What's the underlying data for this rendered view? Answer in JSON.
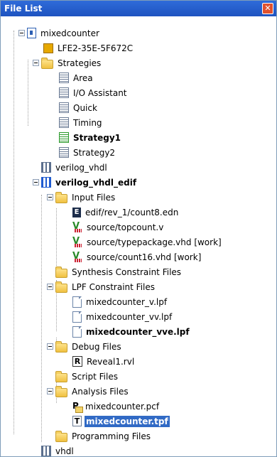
{
  "title": "File List",
  "tree": {
    "root": "mixedcounter",
    "device": "LFE2-35E-5F672C",
    "strategies_folder": "Strategies",
    "strategies": [
      "Area",
      "I/O Assistant",
      "Quick",
      "Timing",
      "Strategy1",
      "Strategy2"
    ],
    "implementations": [
      "verilog_vhdl",
      "verilog_vhdl_edif",
      "vhdl"
    ],
    "input_files_folder": "Input Files",
    "input_files": [
      "edif/rev_1/count8.edn",
      "source/topcount.v",
      "source/typepackage.vhd [work]",
      "source/count16.vhd [work]"
    ],
    "synthesis_folder": "Synthesis Constraint Files",
    "lpf_folder": "LPF Constraint Files",
    "lpf_files": [
      "mixedcounter_v.lpf",
      "mixedcounter_vv.lpf",
      "mixedcounter_vve.lpf"
    ],
    "debug_folder": "Debug Files",
    "debug_files": [
      "Reveal1.rvl"
    ],
    "script_folder": "Script Files",
    "analysis_folder": "Analysis Files",
    "analysis_files": [
      "mixedcounter.pcf",
      "mixedcounter.tpf"
    ],
    "programming_folder": "Programming Files"
  },
  "icons": {
    "close": "close-icon",
    "folder": "folder-icon",
    "file": "file-icon",
    "strategy": "strategy-icon",
    "implementation": "implementation-icon",
    "device": "chip-icon",
    "project": "project-icon"
  },
  "colors": {
    "titlebar": "#2f6bd9",
    "selection": "#316ac5",
    "active_strategy": "#2c9a2c"
  }
}
